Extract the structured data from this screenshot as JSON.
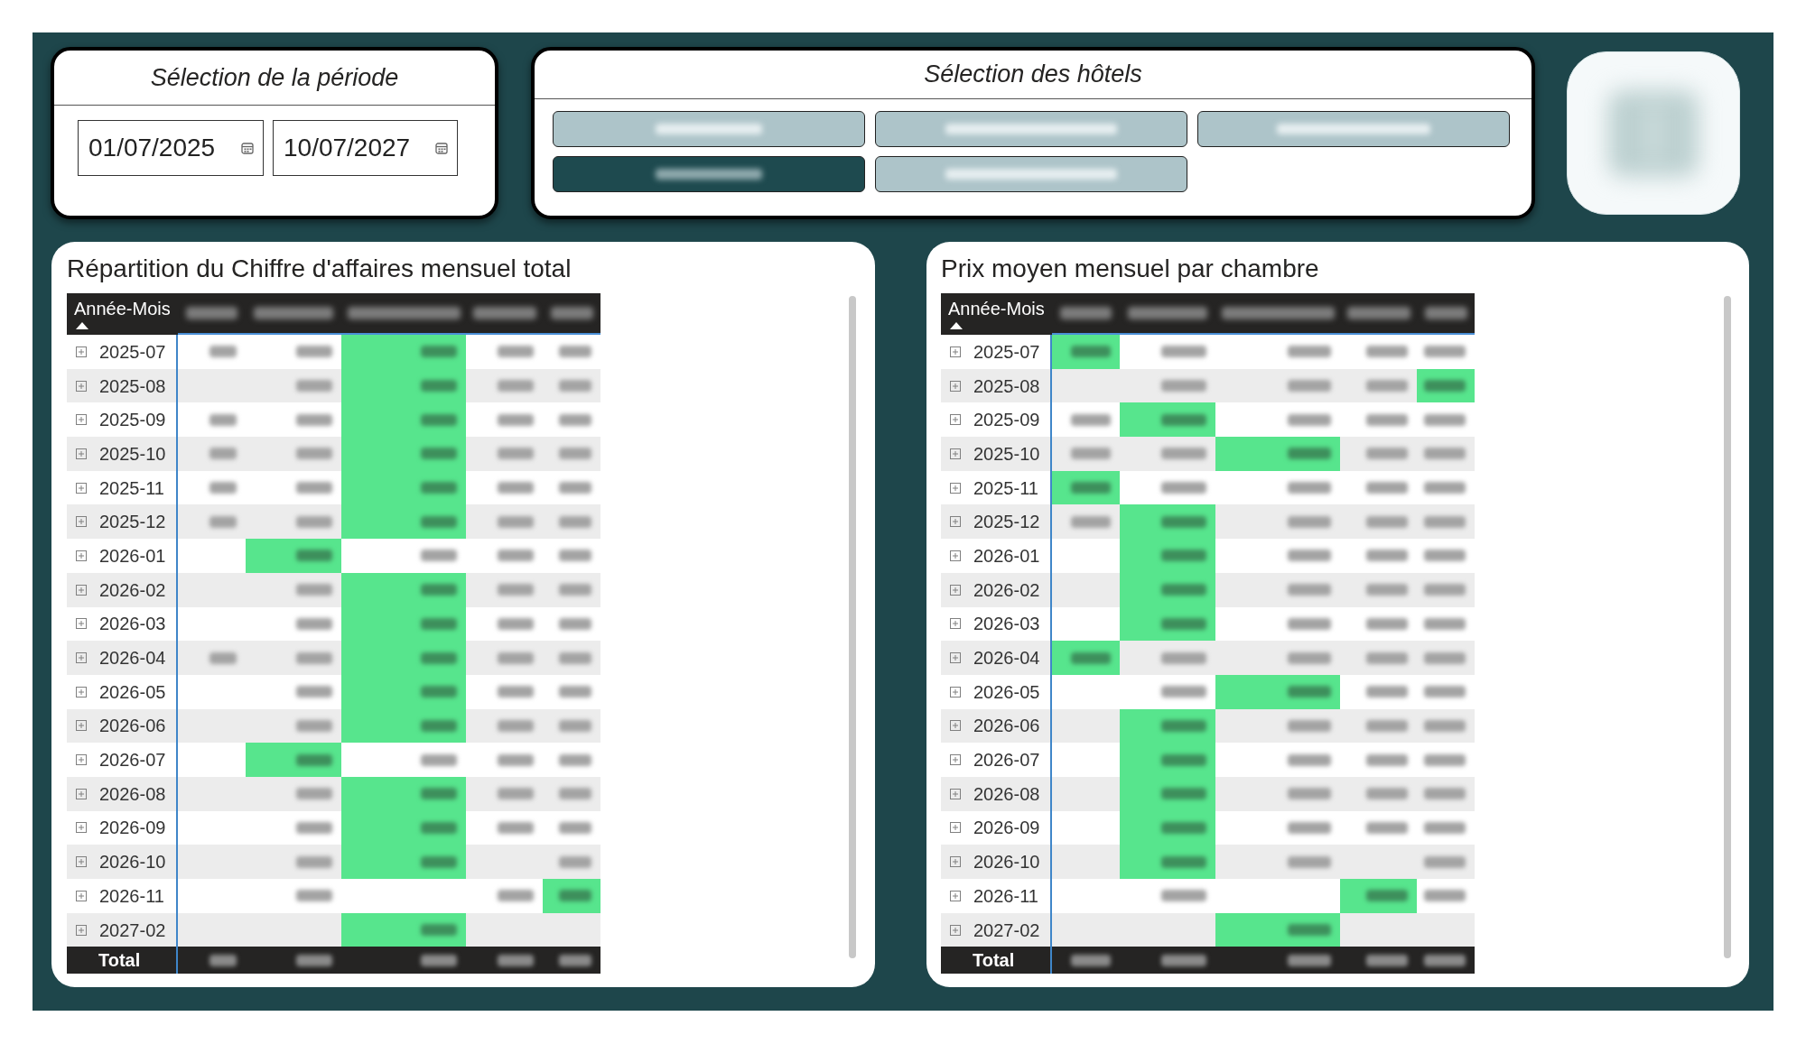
{
  "period_filter": {
    "title": "Sélection de la période",
    "start_date": "01/07/2025",
    "end_date": "10/07/2027"
  },
  "hotel_filter": {
    "title": "Sélection des hôtels",
    "hotels": [
      {
        "label_blurred": true,
        "selected": false
      },
      {
        "label_blurred": true,
        "selected": false
      },
      {
        "label_blurred": true,
        "selected": false
      },
      {
        "label_blurred": true,
        "selected": true
      },
      {
        "label_blurred": true,
        "selected": false
      }
    ]
  },
  "revenue_share_table": {
    "title": "Répartition du Chiffre d'affaires mensuel total",
    "row_header": {
      "label": "Année-Mois",
      "sort_ascending": true
    },
    "value_columns": [
      {
        "label_blurred": true
      },
      {
        "label_blurred": true
      },
      {
        "label_blurred": true
      },
      {
        "label_blurred": true
      },
      {
        "label_blurred": true
      }
    ],
    "rows": [
      {
        "label": "2025-07",
        "expanded": false,
        "cells": [
          {
            "blurred_value": true,
            "highlight": false
          },
          {
            "blurred_value": true,
            "highlight": false
          },
          {
            "blurred_value": true,
            "highlight": true
          },
          {
            "blurred_value": true,
            "highlight": false
          },
          {
            "blurred_value": true,
            "highlight": false
          }
        ]
      },
      {
        "label": "2025-08",
        "expanded": false,
        "cells": [
          {
            "blurred_value": false,
            "highlight": false
          },
          {
            "blurred_value": true,
            "highlight": false
          },
          {
            "blurred_value": true,
            "highlight": true
          },
          {
            "blurred_value": true,
            "highlight": false
          },
          {
            "blurred_value": true,
            "highlight": false
          }
        ]
      },
      {
        "label": "2025-09",
        "expanded": false,
        "cells": [
          {
            "blurred_value": true,
            "highlight": false
          },
          {
            "blurred_value": true,
            "highlight": false
          },
          {
            "blurred_value": true,
            "highlight": true
          },
          {
            "blurred_value": true,
            "highlight": false
          },
          {
            "blurred_value": true,
            "highlight": false
          }
        ]
      },
      {
        "label": "2025-10",
        "expanded": false,
        "cells": [
          {
            "blurred_value": true,
            "highlight": false
          },
          {
            "blurred_value": true,
            "highlight": false
          },
          {
            "blurred_value": true,
            "highlight": true
          },
          {
            "blurred_value": true,
            "highlight": false
          },
          {
            "blurred_value": true,
            "highlight": false
          }
        ]
      },
      {
        "label": "2025-11",
        "expanded": false,
        "cells": [
          {
            "blurred_value": true,
            "highlight": false
          },
          {
            "blurred_value": true,
            "highlight": false
          },
          {
            "blurred_value": true,
            "highlight": true
          },
          {
            "blurred_value": true,
            "highlight": false
          },
          {
            "blurred_value": true,
            "highlight": false
          }
        ]
      },
      {
        "label": "2025-12",
        "expanded": false,
        "cells": [
          {
            "blurred_value": true,
            "highlight": false
          },
          {
            "blurred_value": true,
            "highlight": false
          },
          {
            "blurred_value": true,
            "highlight": true
          },
          {
            "blurred_value": true,
            "highlight": false
          },
          {
            "blurred_value": true,
            "highlight": false
          }
        ]
      },
      {
        "label": "2026-01",
        "expanded": false,
        "cells": [
          {
            "blurred_value": false,
            "highlight": false
          },
          {
            "blurred_value": true,
            "highlight": true
          },
          {
            "blurred_value": true,
            "highlight": false
          },
          {
            "blurred_value": true,
            "highlight": false
          },
          {
            "blurred_value": true,
            "highlight": false
          }
        ]
      },
      {
        "label": "2026-02",
        "expanded": false,
        "cells": [
          {
            "blurred_value": false,
            "highlight": false
          },
          {
            "blurred_value": true,
            "highlight": false
          },
          {
            "blurred_value": true,
            "highlight": true
          },
          {
            "blurred_value": true,
            "highlight": false
          },
          {
            "blurred_value": true,
            "highlight": false
          }
        ]
      },
      {
        "label": "2026-03",
        "expanded": false,
        "cells": [
          {
            "blurred_value": false,
            "highlight": false
          },
          {
            "blurred_value": true,
            "highlight": false
          },
          {
            "blurred_value": true,
            "highlight": true
          },
          {
            "blurred_value": true,
            "highlight": false
          },
          {
            "blurred_value": true,
            "highlight": false
          }
        ]
      },
      {
        "label": "2026-04",
        "expanded": false,
        "cells": [
          {
            "blurred_value": true,
            "highlight": false
          },
          {
            "blurred_value": true,
            "highlight": false
          },
          {
            "blurred_value": true,
            "highlight": true
          },
          {
            "blurred_value": true,
            "highlight": false
          },
          {
            "blurred_value": true,
            "highlight": false
          }
        ]
      },
      {
        "label": "2026-05",
        "expanded": false,
        "cells": [
          {
            "blurred_value": false,
            "highlight": false
          },
          {
            "blurred_value": true,
            "highlight": false
          },
          {
            "blurred_value": true,
            "highlight": true
          },
          {
            "blurred_value": true,
            "highlight": false
          },
          {
            "blurred_value": true,
            "highlight": false
          }
        ]
      },
      {
        "label": "2026-06",
        "expanded": false,
        "cells": [
          {
            "blurred_value": false,
            "highlight": false
          },
          {
            "blurred_value": true,
            "highlight": false
          },
          {
            "blurred_value": true,
            "highlight": true
          },
          {
            "blurred_value": true,
            "highlight": false
          },
          {
            "blurred_value": true,
            "highlight": false
          }
        ]
      },
      {
        "label": "2026-07",
        "expanded": false,
        "cells": [
          {
            "blurred_value": false,
            "highlight": false
          },
          {
            "blurred_value": true,
            "highlight": true
          },
          {
            "blurred_value": true,
            "highlight": false
          },
          {
            "blurred_value": true,
            "highlight": false
          },
          {
            "blurred_value": true,
            "highlight": false
          }
        ]
      },
      {
        "label": "2026-08",
        "expanded": false,
        "cells": [
          {
            "blurred_value": false,
            "highlight": false
          },
          {
            "blurred_value": true,
            "highlight": false
          },
          {
            "blurred_value": true,
            "highlight": true
          },
          {
            "blurred_value": true,
            "highlight": false
          },
          {
            "blurred_value": true,
            "highlight": false
          }
        ]
      },
      {
        "label": "2026-09",
        "expanded": false,
        "cells": [
          {
            "blurred_value": false,
            "highlight": false
          },
          {
            "blurred_value": true,
            "highlight": false
          },
          {
            "blurred_value": true,
            "highlight": true
          },
          {
            "blurred_value": true,
            "highlight": false
          },
          {
            "blurred_value": true,
            "highlight": false
          }
        ]
      },
      {
        "label": "2026-10",
        "expanded": false,
        "cells": [
          {
            "blurred_value": false,
            "highlight": false
          },
          {
            "blurred_value": true,
            "highlight": false
          },
          {
            "blurred_value": true,
            "highlight": true
          },
          {
            "blurred_value": false,
            "highlight": false
          },
          {
            "blurred_value": true,
            "highlight": false
          }
        ]
      },
      {
        "label": "2026-11",
        "expanded": false,
        "cells": [
          {
            "blurred_value": false,
            "highlight": false
          },
          {
            "blurred_value": true,
            "highlight": false
          },
          {
            "blurred_value": false,
            "highlight": false
          },
          {
            "blurred_value": true,
            "highlight": false
          },
          {
            "blurred_value": true,
            "highlight": true
          }
        ]
      },
      {
        "label": "2027-02",
        "expanded": false,
        "cells": [
          {
            "blurred_value": false,
            "highlight": false
          },
          {
            "blurred_value": false,
            "highlight": false
          },
          {
            "blurred_value": true,
            "highlight": true
          },
          {
            "blurred_value": false,
            "highlight": false
          },
          {
            "blurred_value": false,
            "highlight": false
          }
        ]
      }
    ],
    "total": {
      "label": "Total",
      "cells": [
        {
          "blurred_value": true
        },
        {
          "blurred_value": true
        },
        {
          "blurred_value": true
        },
        {
          "blurred_value": true
        },
        {
          "blurred_value": true
        }
      ]
    }
  },
  "average_price_table": {
    "title": "Prix moyen mensuel par chambre",
    "row_header": {
      "label": "Année-Mois",
      "sort_ascending": true
    },
    "value_columns": [
      {
        "label_blurred": true
      },
      {
        "label_blurred": true
      },
      {
        "label_blurred": true
      },
      {
        "label_blurred": true
      },
      {
        "label_blurred": true
      }
    ],
    "rows": [
      {
        "label": "2025-07",
        "expanded": false,
        "cells": [
          {
            "blurred_value": true,
            "highlight": true
          },
          {
            "blurred_value": true,
            "highlight": false
          },
          {
            "blurred_value": true,
            "highlight": false
          },
          {
            "blurred_value": true,
            "highlight": false
          },
          {
            "blurred_value": true,
            "highlight": false
          }
        ]
      },
      {
        "label": "2025-08",
        "expanded": false,
        "cells": [
          {
            "blurred_value": false,
            "highlight": false
          },
          {
            "blurred_value": true,
            "highlight": false
          },
          {
            "blurred_value": true,
            "highlight": false
          },
          {
            "blurred_value": true,
            "highlight": false
          },
          {
            "blurred_value": true,
            "highlight": true
          }
        ]
      },
      {
        "label": "2025-09",
        "expanded": false,
        "cells": [
          {
            "blurred_value": true,
            "highlight": false
          },
          {
            "blurred_value": true,
            "highlight": true
          },
          {
            "blurred_value": true,
            "highlight": false
          },
          {
            "blurred_value": true,
            "highlight": false
          },
          {
            "blurred_value": true,
            "highlight": false
          }
        ]
      },
      {
        "label": "2025-10",
        "expanded": false,
        "cells": [
          {
            "blurred_value": true,
            "highlight": false
          },
          {
            "blurred_value": true,
            "highlight": false
          },
          {
            "blurred_value": true,
            "highlight": true
          },
          {
            "blurred_value": true,
            "highlight": false
          },
          {
            "blurred_value": true,
            "highlight": false
          }
        ]
      },
      {
        "label": "2025-11",
        "expanded": false,
        "cells": [
          {
            "blurred_value": true,
            "highlight": true
          },
          {
            "blurred_value": true,
            "highlight": false
          },
          {
            "blurred_value": true,
            "highlight": false
          },
          {
            "blurred_value": true,
            "highlight": false
          },
          {
            "blurred_value": true,
            "highlight": false
          }
        ]
      },
      {
        "label": "2025-12",
        "expanded": false,
        "cells": [
          {
            "blurred_value": true,
            "highlight": false
          },
          {
            "blurred_value": true,
            "highlight": true
          },
          {
            "blurred_value": true,
            "highlight": false
          },
          {
            "blurred_value": true,
            "highlight": false
          },
          {
            "blurred_value": true,
            "highlight": false
          }
        ]
      },
      {
        "label": "2026-01",
        "expanded": false,
        "cells": [
          {
            "blurred_value": false,
            "highlight": false
          },
          {
            "blurred_value": true,
            "highlight": true
          },
          {
            "blurred_value": true,
            "highlight": false
          },
          {
            "blurred_value": true,
            "highlight": false
          },
          {
            "blurred_value": true,
            "highlight": false
          }
        ]
      },
      {
        "label": "2026-02",
        "expanded": false,
        "cells": [
          {
            "blurred_value": false,
            "highlight": false
          },
          {
            "blurred_value": true,
            "highlight": true
          },
          {
            "blurred_value": true,
            "highlight": false
          },
          {
            "blurred_value": true,
            "highlight": false
          },
          {
            "blurred_value": true,
            "highlight": false
          }
        ]
      },
      {
        "label": "2026-03",
        "expanded": false,
        "cells": [
          {
            "blurred_value": false,
            "highlight": false
          },
          {
            "blurred_value": true,
            "highlight": true
          },
          {
            "blurred_value": true,
            "highlight": false
          },
          {
            "blurred_value": true,
            "highlight": false
          },
          {
            "blurred_value": true,
            "highlight": false
          }
        ]
      },
      {
        "label": "2026-04",
        "expanded": false,
        "cells": [
          {
            "blurred_value": true,
            "highlight": true
          },
          {
            "blurred_value": true,
            "highlight": false
          },
          {
            "blurred_value": true,
            "highlight": false
          },
          {
            "blurred_value": true,
            "highlight": false
          },
          {
            "blurred_value": true,
            "highlight": false
          }
        ]
      },
      {
        "label": "2026-05",
        "expanded": false,
        "cells": [
          {
            "blurred_value": false,
            "highlight": false
          },
          {
            "blurred_value": true,
            "highlight": false
          },
          {
            "blurred_value": true,
            "highlight": true
          },
          {
            "blurred_value": true,
            "highlight": false
          },
          {
            "blurred_value": true,
            "highlight": false
          }
        ]
      },
      {
        "label": "2026-06",
        "expanded": false,
        "cells": [
          {
            "blurred_value": false,
            "highlight": false
          },
          {
            "blurred_value": true,
            "highlight": true
          },
          {
            "blurred_value": true,
            "highlight": false
          },
          {
            "blurred_value": true,
            "highlight": false
          },
          {
            "blurred_value": true,
            "highlight": false
          }
        ]
      },
      {
        "label": "2026-07",
        "expanded": false,
        "cells": [
          {
            "blurred_value": false,
            "highlight": false
          },
          {
            "blurred_value": true,
            "highlight": true
          },
          {
            "blurred_value": true,
            "highlight": false
          },
          {
            "blurred_value": true,
            "highlight": false
          },
          {
            "blurred_value": true,
            "highlight": false
          }
        ]
      },
      {
        "label": "2026-08",
        "expanded": false,
        "cells": [
          {
            "blurred_value": false,
            "highlight": false
          },
          {
            "blurred_value": true,
            "highlight": true
          },
          {
            "blurred_value": true,
            "highlight": false
          },
          {
            "blurred_value": true,
            "highlight": false
          },
          {
            "blurred_value": true,
            "highlight": false
          }
        ]
      },
      {
        "label": "2026-09",
        "expanded": false,
        "cells": [
          {
            "blurred_value": false,
            "highlight": false
          },
          {
            "blurred_value": true,
            "highlight": true
          },
          {
            "blurred_value": true,
            "highlight": false
          },
          {
            "blurred_value": true,
            "highlight": false
          },
          {
            "blurred_value": true,
            "highlight": false
          }
        ]
      },
      {
        "label": "2026-10",
        "expanded": false,
        "cells": [
          {
            "blurred_value": false,
            "highlight": false
          },
          {
            "blurred_value": true,
            "highlight": true
          },
          {
            "blurred_value": true,
            "highlight": false
          },
          {
            "blurred_value": false,
            "highlight": false
          },
          {
            "blurred_value": true,
            "highlight": false
          }
        ]
      },
      {
        "label": "2026-11",
        "expanded": false,
        "cells": [
          {
            "blurred_value": false,
            "highlight": false
          },
          {
            "blurred_value": true,
            "highlight": false
          },
          {
            "blurred_value": false,
            "highlight": false
          },
          {
            "blurred_value": true,
            "highlight": true
          },
          {
            "blurred_value": true,
            "highlight": false
          }
        ]
      },
      {
        "label": "2027-02",
        "expanded": false,
        "cells": [
          {
            "blurred_value": false,
            "highlight": false
          },
          {
            "blurred_value": false,
            "highlight": false
          },
          {
            "blurred_value": true,
            "highlight": true
          },
          {
            "blurred_value": false,
            "highlight": false
          },
          {
            "blurred_value": false,
            "highlight": false
          }
        ]
      }
    ],
    "total": {
      "label": "Total",
      "cells": [
        {
          "blurred_value": true
        },
        {
          "blurred_value": true
        },
        {
          "blurred_value": true
        },
        {
          "blurred_value": true
        },
        {
          "blurred_value": true
        }
      ]
    }
  }
}
